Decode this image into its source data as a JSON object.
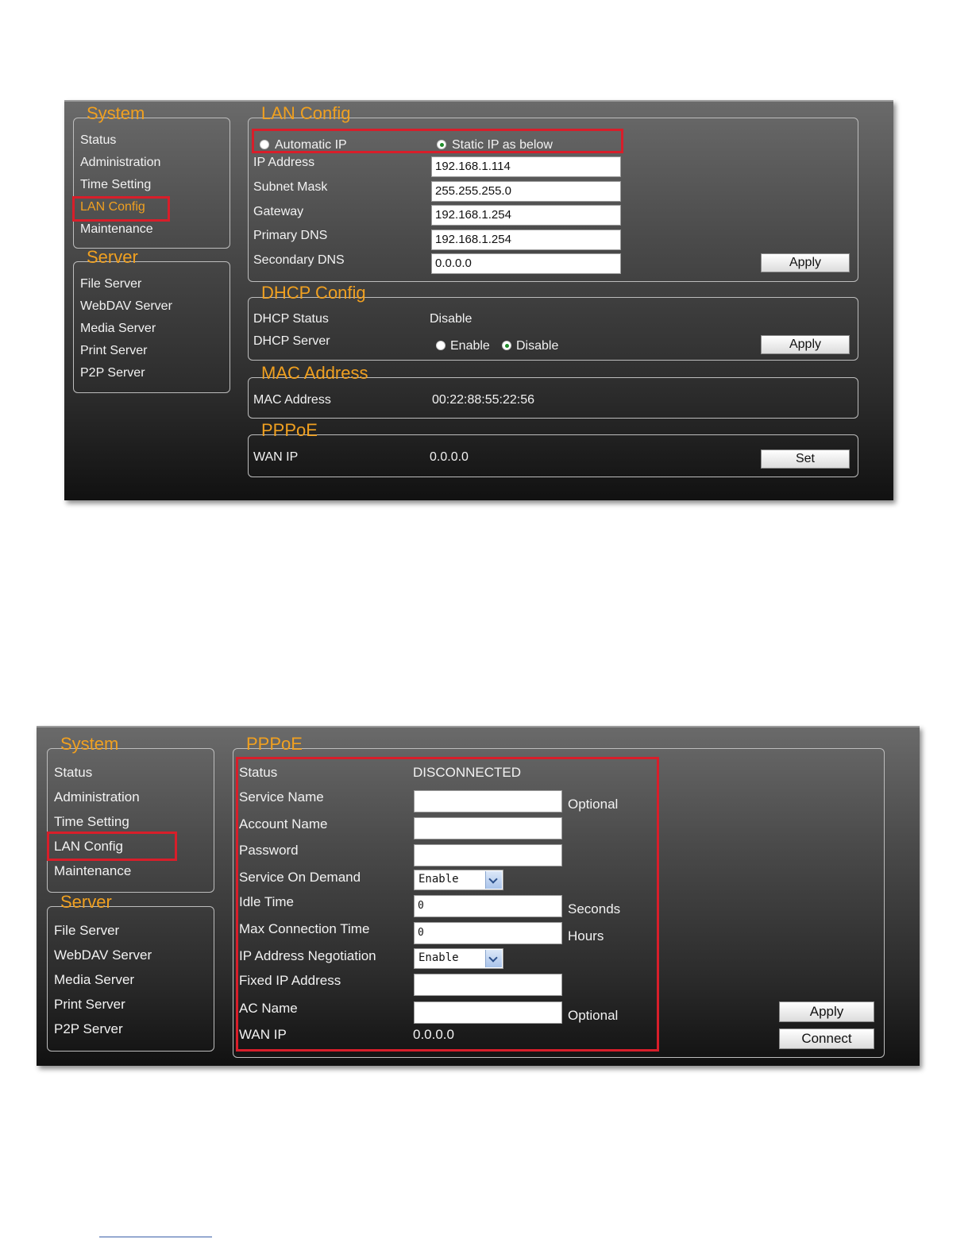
{
  "nav": {
    "system_title": "System",
    "system_items": [
      "Status",
      "Administration",
      "Time Setting",
      "LAN Config",
      "Maintenance"
    ],
    "server_title": "Server",
    "server_items": [
      "File Server",
      "WebDAV Server",
      "Media Server",
      "Print Server",
      "P2P Server"
    ]
  },
  "lan_screen": {
    "lan_config": {
      "title": "LAN Config",
      "automatic_ip": "Automatic IP",
      "static_ip": "Static IP as below",
      "ip_label": "IP Address",
      "ip_value": "192.168.1.114",
      "subnet_label": "Subnet Mask",
      "subnet_value": "255.255.255.0",
      "gateway_label": "Gateway",
      "gateway_value": "192.168.1.254",
      "primary_dns_label": "Primary DNS",
      "primary_dns_value": "192.168.1.254",
      "secondary_dns_label": "Secondary DNS",
      "secondary_dns_value": "0.0.0.0",
      "apply": "Apply"
    },
    "dhcp_config": {
      "title": "DHCP Config",
      "status_label": "DHCP Status",
      "status_value": "Disable",
      "server_label": "DHCP Server",
      "enable": "Enable",
      "disable": "Disable",
      "apply": "Apply"
    },
    "mac": {
      "title": "MAC Address",
      "label": "MAC Address",
      "value": "00:22:88:55:22:56"
    },
    "pppoe": {
      "title": "PPPoE",
      "wan_label": "WAN IP",
      "wan_value": "0.0.0.0",
      "set": "Set"
    }
  },
  "pppoe_screen": {
    "title": "PPPoE",
    "status_label": "Status",
    "status_value": "DISCONNECTED",
    "service_name_label": "Service Name",
    "account_name_label": "Account Name",
    "password_label": "Password",
    "service_on_demand_label": "Service On Demand",
    "service_on_demand_value": "Enable",
    "idle_time_label": "Idle Time",
    "idle_time_value": "0",
    "max_conn_label": "Max Connection Time",
    "max_conn_value": "0",
    "ip_neg_label": "IP Address Negotiation",
    "ip_neg_value": "Enable",
    "fixed_ip_label": "Fixed IP Address",
    "ac_name_label": "AC Name",
    "wan_label": "WAN IP",
    "wan_value": "0.0.0.0",
    "optional": "Optional",
    "seconds": "Seconds",
    "hours": "Hours",
    "apply": "Apply",
    "connect": "Connect"
  },
  "colors": {
    "accent": "#f0a020",
    "highlight": "#d81e2a"
  }
}
